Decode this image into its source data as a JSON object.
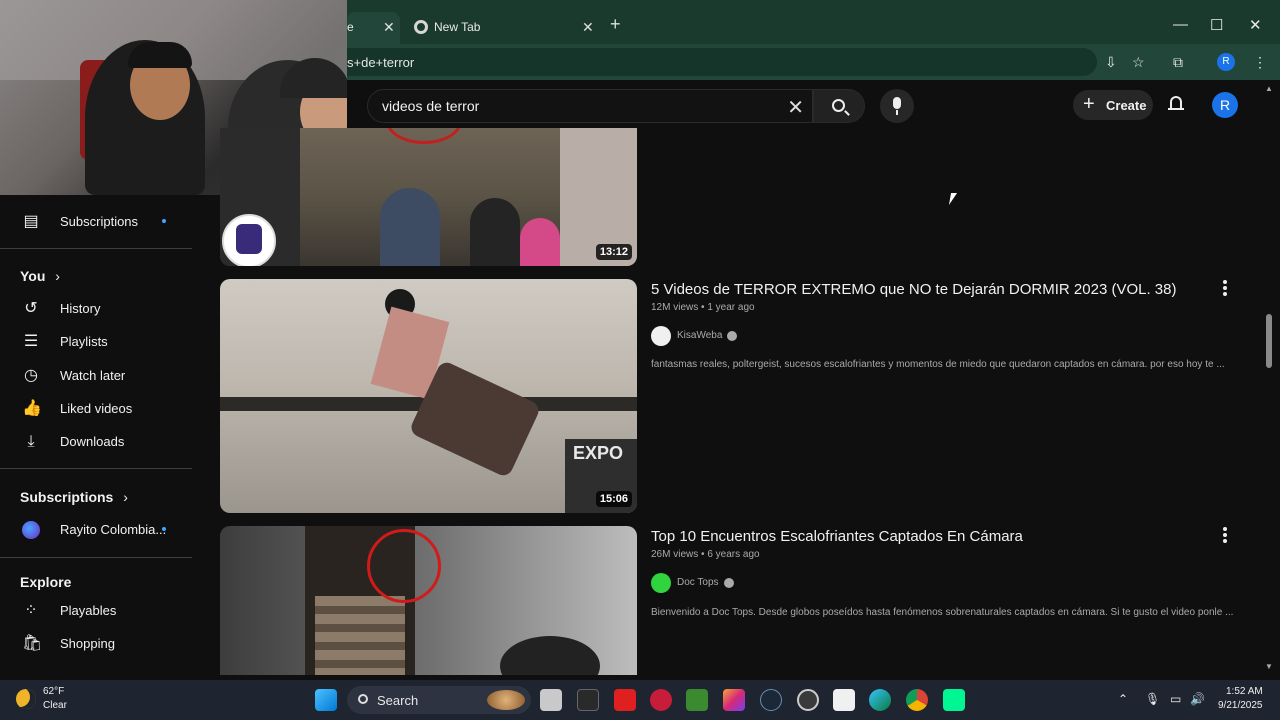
{
  "browser": {
    "tabs": [
      {
        "title": "e",
        "close": "✕"
      },
      {
        "title": "New Tab",
        "close": "✕"
      }
    ],
    "new_tab": "+",
    "address": "s+de+terror",
    "window_controls": {
      "minimize": "—",
      "maximize": "☐",
      "close": "✕"
    },
    "profile_initial": "R"
  },
  "youtube": {
    "search_query": "videos de terror",
    "create_label": "Create",
    "avatar_initial": "R"
  },
  "sidebar": {
    "top_items": [
      {
        "label": "Subscriptions",
        "icon": "subscriptions-icon",
        "glyph": "▤",
        "dot": true
      }
    ],
    "you_header": "You",
    "you_items": [
      {
        "label": "History",
        "icon": "history-icon",
        "glyph": "↺"
      },
      {
        "label": "Playlists",
        "icon": "playlists-icon",
        "glyph": "☰"
      },
      {
        "label": "Watch later",
        "icon": "watch-later-icon",
        "glyph": "◷"
      },
      {
        "label": "Liked videos",
        "icon": "thumbs-up-icon",
        "glyph": "👍"
      },
      {
        "label": "Downloads",
        "icon": "download-icon",
        "glyph": "⤓"
      }
    ],
    "subscriptions_header": "Subscriptions",
    "subscriptions": [
      {
        "label": "Rayito Colombia...",
        "dot": true
      }
    ],
    "explore_header": "Explore",
    "explore_items": [
      {
        "label": "Playables",
        "icon": "playables-icon",
        "glyph": "⁘"
      },
      {
        "label": "Shopping",
        "icon": "shopping-bag-icon",
        "glyph": "🛍"
      }
    ]
  },
  "results": [
    {
      "title": "",
      "duration": "13:12"
    },
    {
      "title": "5 Videos de TERROR EXTREMO que NO te Dejarán DORMIR 2023 (VOL. 38)",
      "views": "12M views",
      "age": "1 year ago",
      "channel": "KisaWeba",
      "description": "fantasmas reales, poltergeist, sucesos escalofriantes y momentos de miedo que quedaron captados en cámara. por eso hoy te ...",
      "duration": "15:06"
    },
    {
      "title": "Top 10 Encuentros Escalofriantes Captados En Cámara",
      "views": "26M views",
      "age": "6 years ago",
      "channel": "Doc Tops",
      "description": "Bienvenido a Doc Tops. Desde globos poseídos hasta fenómenos sobrenaturales captados en cámara. Si te gusto el video ponle ..."
    }
  ],
  "taskbar": {
    "weather_temp": "62°F",
    "weather_cond": "Clear",
    "search_label": "Search",
    "time": "1:52 AM",
    "date": "9/21/2025"
  },
  "colors": {
    "browser_frame": "#1b3a2e",
    "yt_background": "#0f0f0f",
    "accent_blue": "#1a73e8",
    "new_dot": "#3ea6ff"
  }
}
